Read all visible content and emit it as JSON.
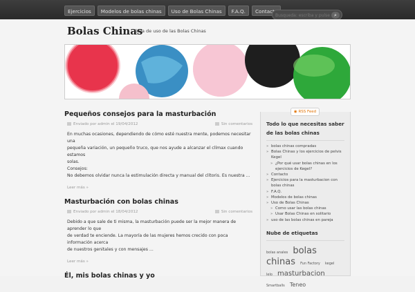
{
  "nav": {
    "items": [
      "Ejercicios",
      "Modelos de bolas chinas",
      "Uso de Bolas Chinas",
      "F.A.Q.",
      "Contacto"
    ]
  },
  "search": {
    "placeholder": "Busqueda: escriba y pulse ente"
  },
  "site": {
    "title": "Bolas Chinas",
    "tagline": "Guía de uso de las Bolas Chinas"
  },
  "posts": [
    {
      "title": "Pequeños consejos para la masturbación",
      "meta": "Enviado por admin el 19/04/2012",
      "comments": "Sin comentarios",
      "excerpt": [
        "En muchas ocasiones, dependiendo de cómo esté nuestra mente, podemos necesitar una",
        "pequeña variación, un pequeño truco, que nos ayude a alcanzar el clímax cuando estamos",
        "solas.",
        "Consejos:",
        "No debemos olvidar nunca la estimulación directa y manual del clítoris. Es nuestra ..."
      ],
      "more": "Leer más »"
    },
    {
      "title": "Masturbación con bolas chinas",
      "meta": "Enviado por admin el 18/04/2012",
      "comments": "Sin comentarios",
      "excerpt": [
        "Debido a que sale de ti misma, la masturbación puede ser la mejor manera de aprender lo que",
        "de verdad te enciende. La mayoría de las mujeres hemos crecido con poca información acerca",
        "de nuestros genitales y con mensajes ..."
      ],
      "more": "Leer más »"
    },
    {
      "title": "Él, mis bolas chinas y yo"
    }
  ],
  "sidebar": {
    "rss": "RSS Feed",
    "heading": "Todo lo que necesitas saber de las bolas chinas",
    "links": [
      {
        "label": "bolas chinas compradas",
        "sub": false
      },
      {
        "label": "Bolas Chinas y los ejercicios de pelvis Kegel",
        "sub": false
      },
      {
        "label": "¿Por qué usar bolas chinas en los ejercicios de Kegel?",
        "sub": true
      },
      {
        "label": "Contacto",
        "sub": false
      },
      {
        "label": "Ejercicios para la masturbacion con bolas chinas",
        "sub": false
      },
      {
        "label": "F.A.Q.",
        "sub": false
      },
      {
        "label": "Modelos de bolas chinas",
        "sub": false
      },
      {
        "label": "Uso de Bolas Chinas",
        "sub": false
      },
      {
        "label": "Como usar las bolas chinas",
        "sub": true
      },
      {
        "label": "Usar Bolas Chinas en solitario",
        "sub": true
      },
      {
        "label": "uso de las bolas chinas en pareja",
        "sub": false
      }
    ],
    "tags_heading": "Nube de etiquetas",
    "tags": [
      {
        "label": "bolas anales",
        "size": 5
      },
      {
        "label": "bolas chinas",
        "size": 13
      },
      {
        "label": "Fun Factory",
        "size": 5
      },
      {
        "label": "kegel",
        "size": 5
      },
      {
        "label": "lelo",
        "size": 5
      },
      {
        "label": "masturbacion",
        "size": 10
      },
      {
        "label": "Smartballs",
        "size": 5
      },
      {
        "label": "Teneo",
        "size": 8
      }
    ]
  },
  "colors": {
    "accent": "#222222",
    "topbar": "#333333",
    "rss": "#e07000"
  }
}
